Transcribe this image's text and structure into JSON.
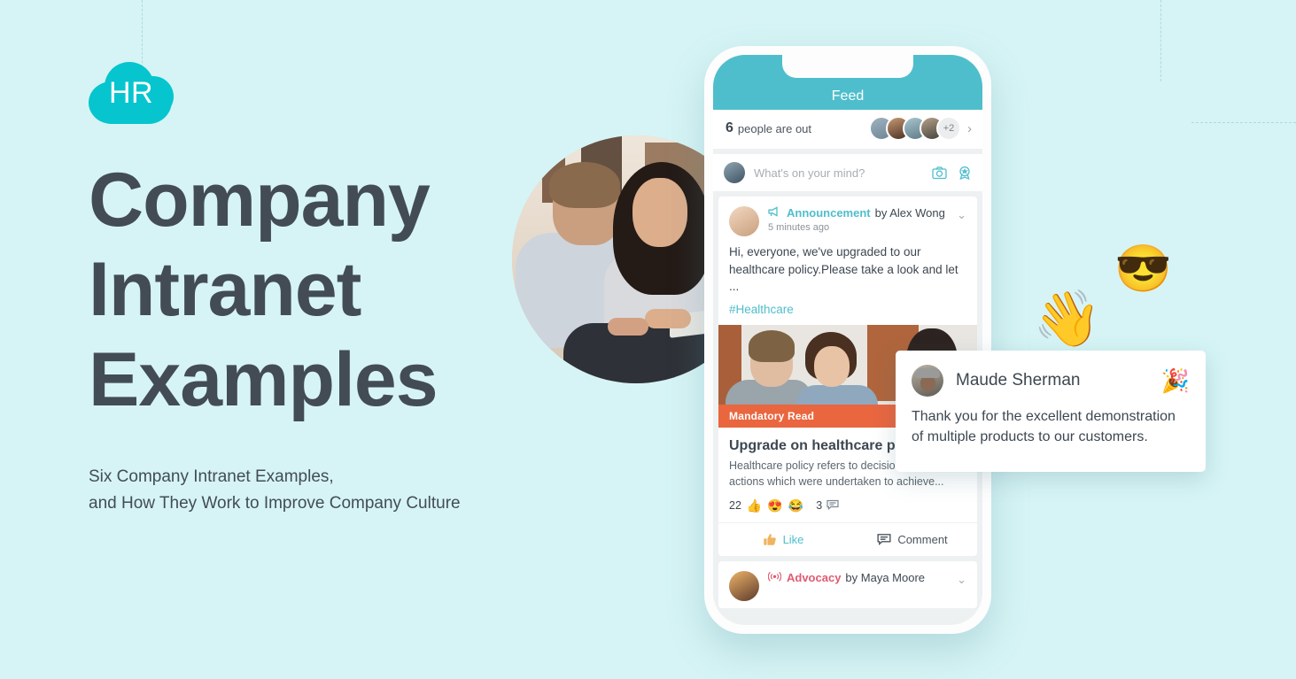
{
  "background_color": "#d6f4f5",
  "brand": {
    "logo_text": "HR",
    "logo_color": "#06c5ce"
  },
  "hero": {
    "title": "Company\nIntranet\nExamples",
    "title_color": "#434c55",
    "subtitle": "Six Company Intranet Examples,\nand How They Work to Improve Company Culture"
  },
  "photo": {
    "alt_name": "two-colleagues-with-laptop"
  },
  "phone": {
    "header": {
      "title": "Feed",
      "color": "#4fbecc"
    },
    "out_row": {
      "count": "6",
      "label": "people are out",
      "more_badge": "+2",
      "chevron": "›"
    },
    "compose": {
      "placeholder": "What's on your mind?",
      "camera_icon": "camera-icon",
      "badge_icon": "award-icon"
    },
    "posts": [
      {
        "type_label": "Announcement",
        "type_color": "#4fbecc",
        "by_label": "by Alex Wong",
        "time": "5 minutes ago",
        "body": "Hi, everyone, we've upgraded to our\nhealthcare policy.Please take a look and let ...",
        "hashtag": "#Healthcare",
        "image_badge": "Mandatory Read",
        "image_badge_color": "#e9663f",
        "title": "Upgrade on healthcare policy",
        "excerpt": "Healthcare policy refers to decisions, plans, and\nactions which were undertaken to achieve...",
        "reaction_count": "22",
        "reaction_emojis": [
          "👍",
          "😍",
          "😂"
        ],
        "comment_count": "3",
        "like_label": "Like",
        "comment_label": "Comment"
      },
      {
        "type_label": "Advocacy",
        "type_color": "#e05b72",
        "by_label": "by Maya Moore"
      }
    ]
  },
  "tooltip": {
    "name": "Maude Sherman",
    "emoji": "🎉",
    "message": "Thank you for the excellent demonstration\nof multiple products to our customers."
  },
  "decor": {
    "emoji_sunglasses": "😎",
    "emoji_wave": "👋"
  }
}
